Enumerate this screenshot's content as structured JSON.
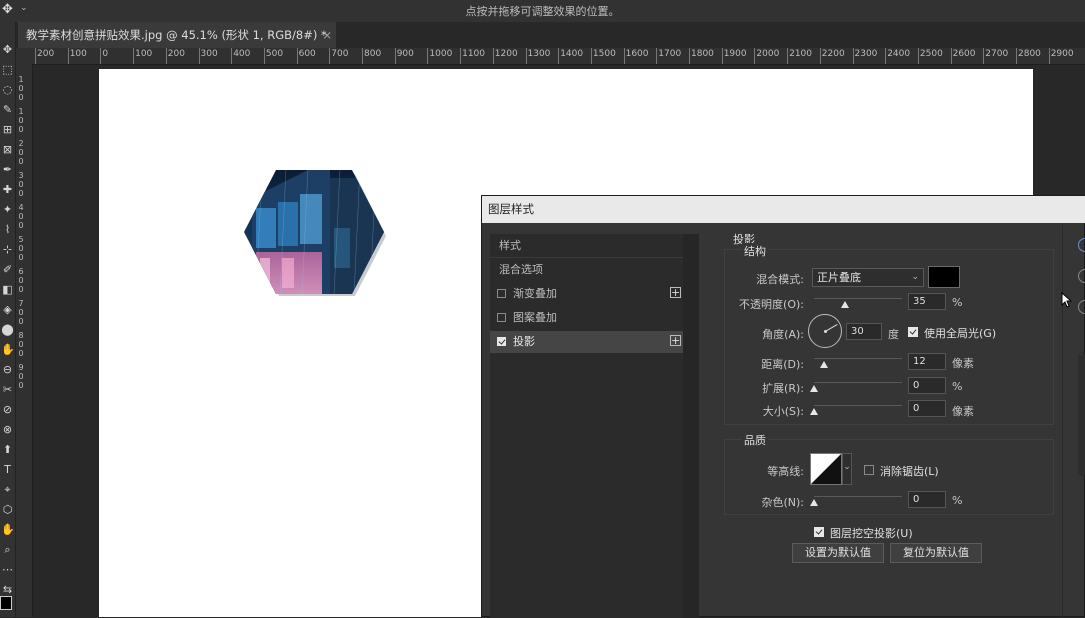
{
  "topbar": {
    "hint": "点按并拖移可调整效果的位置。",
    "move_icon": "move-tool-icon",
    "chevron": "⌄"
  },
  "document": {
    "tab_title": "教学素材创意拼贴效果.jpg @ 45.1% (形状 1, RGB/8#) *",
    "close_glyph": "×"
  },
  "ruler": {
    "h_labels": [
      "200",
      "100",
      "0",
      "100",
      "200",
      "300",
      "400",
      "500",
      "600",
      "700",
      "800",
      "900",
      "1000",
      "1100",
      "1200",
      "1300",
      "1400",
      "1500",
      "1600",
      "1700",
      "1800",
      "1900",
      "2000",
      "2100",
      "2200",
      "2300",
      "2400",
      "2500",
      "2600",
      "2700",
      "2800",
      "2900"
    ],
    "v_labels": [
      "1",
      "0",
      "0",
      "1",
      "0",
      "0",
      "2",
      "0",
      "0",
      "3",
      "0",
      "0",
      "4",
      "0",
      "0",
      "5",
      "0",
      "0",
      "6",
      "0",
      "0",
      "7",
      "0",
      "0",
      "8",
      "0",
      "0",
      "9",
      "0",
      "0"
    ]
  },
  "dialog": {
    "title": "图层样式",
    "styles_list": {
      "items": [
        {
          "label": "样式",
          "checkbox": false,
          "checked": false,
          "plus": false,
          "selected": false
        },
        {
          "label": "混合选项",
          "checkbox": false,
          "checked": false,
          "plus": false,
          "selected": false
        },
        {
          "label": "渐变叠加",
          "checkbox": true,
          "checked": false,
          "plus": true,
          "selected": false
        },
        {
          "label": "图案叠加",
          "checkbox": true,
          "checked": false,
          "plus": false,
          "selected": false
        },
        {
          "label": "投影",
          "checkbox": true,
          "checked": true,
          "plus": true,
          "selected": true
        }
      ],
      "plus_glyph": "+"
    },
    "drop_shadow": {
      "section_title": "投影",
      "structure_title": "结构",
      "blend_mode_label": "混合模式:",
      "blend_mode_value": "正片叠底",
      "shadow_color": "#000000",
      "opacity_label": "不透明度(O):",
      "opacity_value": "35",
      "opacity_unit": "%",
      "opacity_fraction": 0.35,
      "angle_label": "角度(A):",
      "angle_value": "30",
      "angle_unit": "度",
      "global_light_label": "使用全局光(G)",
      "global_light_checked": true,
      "distance_label": "距离(D):",
      "distance_value": "12",
      "distance_unit": "像素",
      "spread_label": "扩展(R):",
      "spread_value": "0",
      "spread_unit": "%",
      "size_label": "大小(S):",
      "size_value": "0",
      "size_unit": "像素",
      "quality_title": "品质",
      "contour_label": "等高线:",
      "antialias_label": "消除锯齿(L)",
      "antialias_checked": false,
      "noise_label": "杂色(N):",
      "noise_value": "0",
      "noise_unit": "%",
      "knockout_label": "图层挖空投影(U)",
      "knockout_checked": true,
      "set_default_button": "设置为默认值",
      "reset_default_button": "复位为默认值"
    }
  },
  "toolbar": {
    "tools": [
      "✥",
      "⬚",
      "◌",
      "✎",
      "⊞",
      "⊠",
      "✒",
      "✚",
      "✦",
      "⌇",
      "⊹",
      "✐",
      "◧",
      "◈",
      "⬤",
      "✋",
      "⊖",
      "✂",
      "⊘",
      "⊗",
      "⬆",
      "T",
      "⌖",
      "⬡",
      "✋",
      "⌕",
      "⋯",
      "⇆"
    ]
  }
}
